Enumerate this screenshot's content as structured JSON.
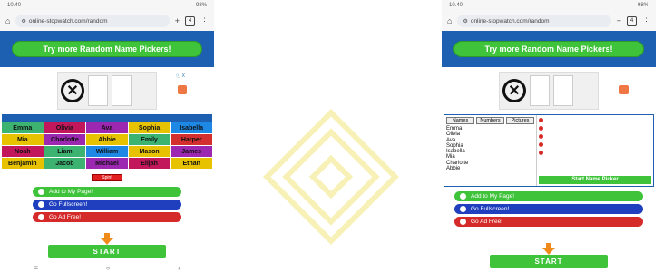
{
  "left": {
    "status": {
      "time": "10.40",
      "battery": "98%"
    },
    "url": "online-stopwatch.com/random",
    "tab_count": "4",
    "try_more_label": "Try more Random Name Pickers!",
    "ad_mark": "ⓘ X",
    "names": [
      {
        "text": "Emma",
        "bg": "#3cb371"
      },
      {
        "text": "Olivia",
        "bg": "#c2185b"
      },
      {
        "text": "Ava",
        "bg": "#9c27b0"
      },
      {
        "text": "Sophia",
        "bg": "#e6c200"
      },
      {
        "text": "Isabella",
        "bg": "#1e88e5"
      },
      {
        "text": "Mia",
        "bg": "#e6c200"
      },
      {
        "text": "Charlotte",
        "bg": "#9c27b0"
      },
      {
        "text": "Abbie",
        "bg": "#e6c200"
      },
      {
        "text": "Emily",
        "bg": "#3cb371"
      },
      {
        "text": "Harper",
        "bg": "#d32f2f"
      },
      {
        "text": "Noah",
        "bg": "#c2185b"
      },
      {
        "text": "Liam",
        "bg": "#3cb371"
      },
      {
        "text": "William",
        "bg": "#1e88e5"
      },
      {
        "text": "Mason",
        "bg": "#e6c200"
      },
      {
        "text": "James",
        "bg": "#9c27b0"
      },
      {
        "text": "Benjamin",
        "bg": "#e6c200"
      },
      {
        "text": "Jacob",
        "bg": "#3cb371"
      },
      {
        "text": "Michael",
        "bg": "#9c27b0"
      },
      {
        "text": "Elijah",
        "bg": "#c2185b"
      },
      {
        "text": "Ethan",
        "bg": "#e6c200"
      }
    ],
    "spin_label": "Spin!",
    "add_label": "Add to My Page!",
    "fullscreen_label": "Go Fullscreen!",
    "adfree_label": "Go Ad Free!",
    "start_label": "START"
  },
  "right": {
    "status": {
      "time": "10.40",
      "battery": "98%"
    },
    "url": "online-stopwatch.com/random",
    "tab_count": "4",
    "try_more_label": "Try more Random Name Pickers!",
    "tabs": [
      "Names",
      "Numbers",
      "Pictures"
    ],
    "names_list": [
      "Emma",
      "Olivia",
      "Ava",
      "Sophia",
      "Isabella",
      "Mia",
      "Charlotte",
      "Abbie"
    ],
    "start_picker_label": "Start Name Picker",
    "add_label": "Add to My Page!",
    "fullscreen_label": "Go Fullscreen!",
    "adfree_label": "Go Ad Free!",
    "start_label": "START"
  },
  "colors": {
    "brand_blue": "#1d5fb0",
    "green": "#3ec33a",
    "red": "#d52a2a",
    "orange": "#f08a1a"
  }
}
